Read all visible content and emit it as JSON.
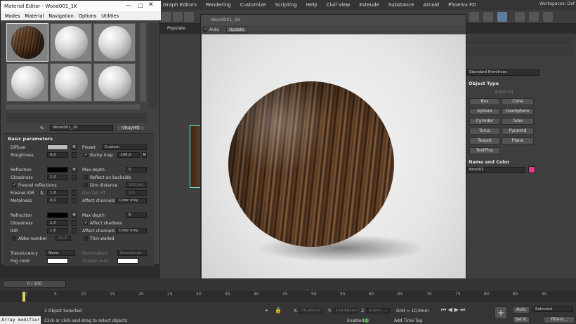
{
  "menu": [
    "Graph Editors",
    "Rendering",
    "Customize",
    "Scripting",
    "Help",
    "Civil View",
    "Ksteude",
    "Substance",
    "Arnold",
    "Phoenix FD"
  ],
  "workspaces": "Workspaces: Def",
  "populate": "Populate",
  "material_editor": {
    "title": "Material Editor - Wood001_1K",
    "menu": [
      "Modes",
      "Material",
      "Navigation",
      "Options",
      "Utilities"
    ],
    "material_name": "Wood001_1K",
    "material_type": "VRayMtl",
    "section": "Basic parameters",
    "diffuse": "Diffuse",
    "roughness": "Roughness",
    "roughness_val": "0,0",
    "preset": "Preset",
    "preset_val": "Custom",
    "bump": "Bump map",
    "bump_val": "100,0",
    "reflection": "Reflection",
    "glossiness": "Glossiness",
    "gloss_val": "1,0",
    "max_depth": "Max depth",
    "max_depth_val": "5",
    "reflect_backside": "Reflect on backside",
    "dim_distance": "Dim distance",
    "dim_val": "100,0m",
    "fresnel": "Fresnel reflections",
    "fresnel_ior": "Fresnel IOR",
    "fresnel_l": "L",
    "fresnel_val": "1,6",
    "dim_falloff": "Dim fall off",
    "falloff_val": "0,0",
    "metalness": "Metalness",
    "metal_val": "0,0",
    "affect_channels": "Affect channels",
    "color_only": "Color only",
    "refraction": "Refraction",
    "refr_gloss": "Glossiness",
    "refr_gloss_val": "1,0",
    "ior": "IOR",
    "ior_val": "1,6",
    "refr_depth_val": "5",
    "affect_shadows": "Affect shadows",
    "abbe": "Abbe number",
    "abbe_val": "50,0",
    "thin": "Thin-walled",
    "translucency": "Translucency",
    "transl_val": "None",
    "illumination": "Illumination",
    "illum_val": "Directional",
    "fog": "Fog color",
    "scatter": "Scatter color"
  },
  "render": {
    "title": "Wood001_1K",
    "auto": "Auto",
    "update": "Update"
  },
  "panel": {
    "dropdown": "Standard Primitives",
    "object_type": "Object Type",
    "autogrid": "AutoGrid",
    "buttons": [
      "Box",
      "Cone",
      "Sphere",
      "GeoSphere",
      "Cylinder",
      "Tube",
      "Torus",
      "Pyramid",
      "Teapot",
      "Plane",
      "TextPlus"
    ],
    "name_color": "Name and Color",
    "name_val": "Box001",
    "swatch": "#e43a8a"
  },
  "timeline": {
    "frame": "0 / 100",
    "ticks": [
      "0",
      "5",
      "10",
      "15",
      "20",
      "25",
      "30",
      "35",
      "40",
      "45",
      "50",
      "55",
      "60",
      "65",
      "70",
      "75",
      "80",
      "85",
      "90"
    ]
  },
  "status": {
    "selected": "1 Object Selected",
    "hint": "Click or click-and-drag to select objects",
    "listener": "Array modifier",
    "x": "X:",
    "x_val": "75,901cm",
    "y": "Y:",
    "y_val": "118,882cm",
    "z": "Z:",
    "z_val": "0,0cm",
    "grid": "Grid = 10,0mm",
    "enabled": "Enabled:",
    "add_tag": "Add Time Tag",
    "auto": "Auto",
    "set_k": "Set K.",
    "selected_dd": "Selected",
    "filters": "Filters..."
  }
}
